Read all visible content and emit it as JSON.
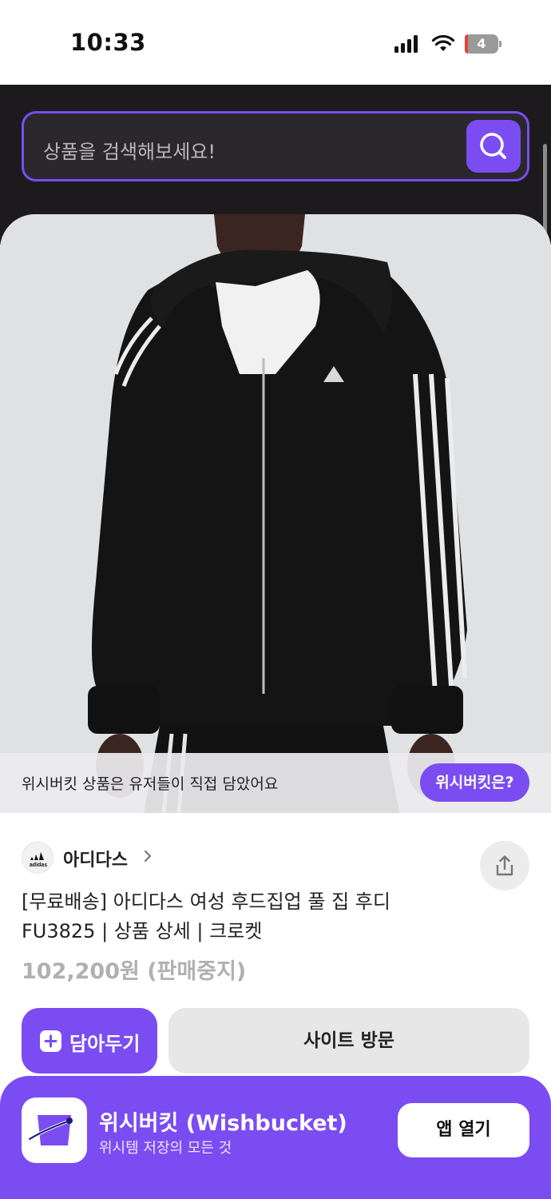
{
  "status_bar": {
    "time": "10:33",
    "battery_level": "4",
    "battery_fraction": 0.04,
    "battery_color": "#e0453a"
  },
  "search": {
    "placeholder": "상품을 검색해보세요!",
    "icon": "search-icon"
  },
  "product_image": {
    "description_icon": "product-photo",
    "info_text": "위시버킷 상품은 유저들이 직접 담았어요",
    "info_button": "위시버킷은?"
  },
  "brand": {
    "name": "아디다스",
    "logo_text": "adidas",
    "icon": "chevron-right-icon"
  },
  "product": {
    "title": "[무료배송] 아디다스 여성 후드집업 풀 집 후디 FU3825 | 상품 상세 | 크로켓",
    "price": "102,200원 (판매중지)"
  },
  "actions": {
    "save_label": "담아두기",
    "visit_label": "사이트 방문",
    "share_icon": "share-icon"
  },
  "app_banner": {
    "name": "위시버킷 (Wishbucket)",
    "tagline": "위시템 저장의 모든 것",
    "open_label": "앱 열기"
  },
  "colors": {
    "accent": "#7b4cf2",
    "header_bg": "#1c1a1d",
    "price_muted": "#b0b0b2"
  }
}
